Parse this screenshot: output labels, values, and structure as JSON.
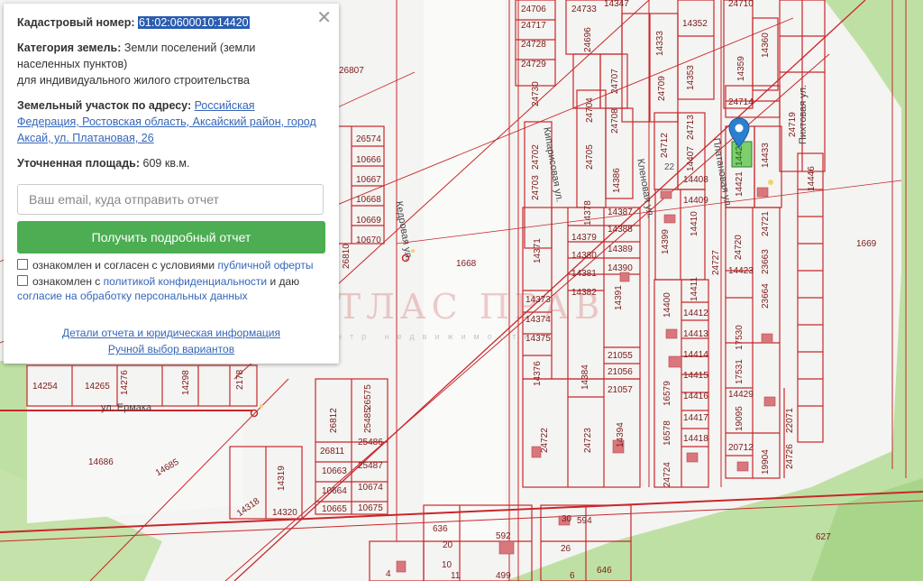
{
  "popup": {
    "cadastral_label": "Кадастровый номер:",
    "cadastral_value": "61:02:0600010:14420",
    "category_label": "Категория земель:",
    "category_line1": "Земли поселений (земли",
    "category_line2": "населенных пунктов)",
    "category_line3": "для индивидуального жилого строительства",
    "address_label": "Земельный участок по адресу:",
    "address_link1": "Российская",
    "address_link2": "Федерация, Ростовская область, Аксайский район, город",
    "address_link3": "Аксай, ул. Платановая, 26",
    "area_label": "Уточненная площадь:",
    "area_value": "609 кв.м.",
    "email_placeholder": "Ваш email, куда отправить отчет",
    "button_label": "Получить подробный отчет",
    "check1_text": "ознакомлен и согласен с условиями",
    "check1_link": "публичной оферты",
    "check2_text": "ознакомлен с",
    "check2_link": "политикой конфиденциальности",
    "check2_text2": "и даю",
    "check2_link2": "согласие на обработку персональных данных",
    "details_link": "Детали отчета и юридическая информация",
    "manual_link": "Ручной выбор вариантов",
    "close_symbol": "✕"
  },
  "watermark": {
    "title": "АТЛАС ПРАВ",
    "subtitle": "центр недвижимости"
  },
  "streets": {
    "kedrovaya": "Кедровая ул.",
    "kiparisovaya": "Кипарисовая ул.",
    "klenovaya": "Кленовая ул.",
    "platanovaya": "Платановая ул.",
    "pikhtovaya": "Пихтовая ул.",
    "ermaka": "ул. Ермака"
  },
  "colors": {
    "parcel_line": "#c8272b",
    "green_area": "#b8dc9c",
    "selected_parcel": "#7ccf6a",
    "button": "#4cad52",
    "marker": "#2b7fd1"
  },
  "parcels": {
    "p24706": "24706",
    "p24717": "24717",
    "p24728": "24728",
    "p24729": "24729",
    "p24733": "24733",
    "p14347": "14347",
    "p24696": "24696",
    "p24730": "24730",
    "p24707": "24707",
    "p24704": "24704",
    "p24708": "24708",
    "p24702": "24702",
    "p24705": "24705",
    "p24703": "24703",
    "p14333": "14333",
    "p24709": "24709",
    "p14352": "14352",
    "p14353": "14353",
    "p24710": "24710",
    "p14360": "14360",
    "p14359": "14359",
    "p24714": "24714",
    "p24713": "24713",
    "p24712": "24712",
    "p14407": "14407",
    "p14408": "14408",
    "p14409": "14409",
    "p14410": "14410",
    "p14399": "14399",
    "p14420": "14420",
    "p14421": "14421",
    "p14433": "14433",
    "p24719": "24719",
    "p14446": "14446",
    "p26807": "26807",
    "p26574": "26574",
    "p10666": "10666",
    "p10667": "10667",
    "p10668": "10668",
    "p10669": "10669",
    "p10670": "10670",
    "p26810": "26810",
    "p1668": "1668",
    "p14371": "14371",
    "p14378": "14378",
    "p14386": "14386",
    "p14387": "14387",
    "p14379": "14379",
    "p14388": "14388",
    "p14380": "14380",
    "p14389": "14389",
    "p14381": "14381",
    "p14390": "14390",
    "p14382": "14382",
    "p14373": "14373",
    "p14391": "14391",
    "p14374": "14374",
    "p14375": "14375",
    "p14376": "14376",
    "p14384": "14384",
    "p21055": "21055",
    "p21056": "21056",
    "p21057": "21057",
    "p24720": "24720",
    "p24721": "24721",
    "p24727": "24727",
    "p14423": "14423",
    "p23663": "23663",
    "p23664": "23664",
    "p14400": "14400",
    "p14411": "14411",
    "p14412": "14412",
    "p14413": "14413",
    "p14414": "14414",
    "p14415": "14415",
    "p14416": "14416",
    "p14417": "14417",
    "p14418": "14418",
    "p14429": "14429",
    "p17530": "17530",
    "p17531": "17531",
    "p16579": "16579",
    "p16578": "16578",
    "p19095": "19095",
    "p22071": "22071",
    "p20712": "20712",
    "p19904": "19904",
    "p24726": "24726",
    "p24724": "24724",
    "p24722": "24722",
    "p24723": "24723",
    "p14394": "14394",
    "p1669": "1669",
    "p26575": "26575",
    "p26812": "26812",
    "p25485": "25485",
    "p26811": "26811",
    "p25486": "25486",
    "p25487": "25487",
    "p10663": "10663",
    "p10664": "10664",
    "p10674": "10674",
    "p10665": "10665",
    "p10675": "10675",
    "p14254": "14254",
    "p14265": "14265",
    "p14276": "14276",
    "p14298": "14298",
    "p2178": "2178",
    "p14686": "14686",
    "p14685": "14685",
    "p14319": "14319",
    "p14318": "14318",
    "p14320": "14320",
    "p636": "636",
    "p592": "592",
    "p594": "594",
    "p627": "627",
    "p499": "499",
    "p646": "646",
    "p11": "11",
    "p20": "20",
    "p26": "26",
    "p30": "30",
    "p22": "22",
    "p10": "10",
    "p6": "6",
    "p4": "4"
  }
}
